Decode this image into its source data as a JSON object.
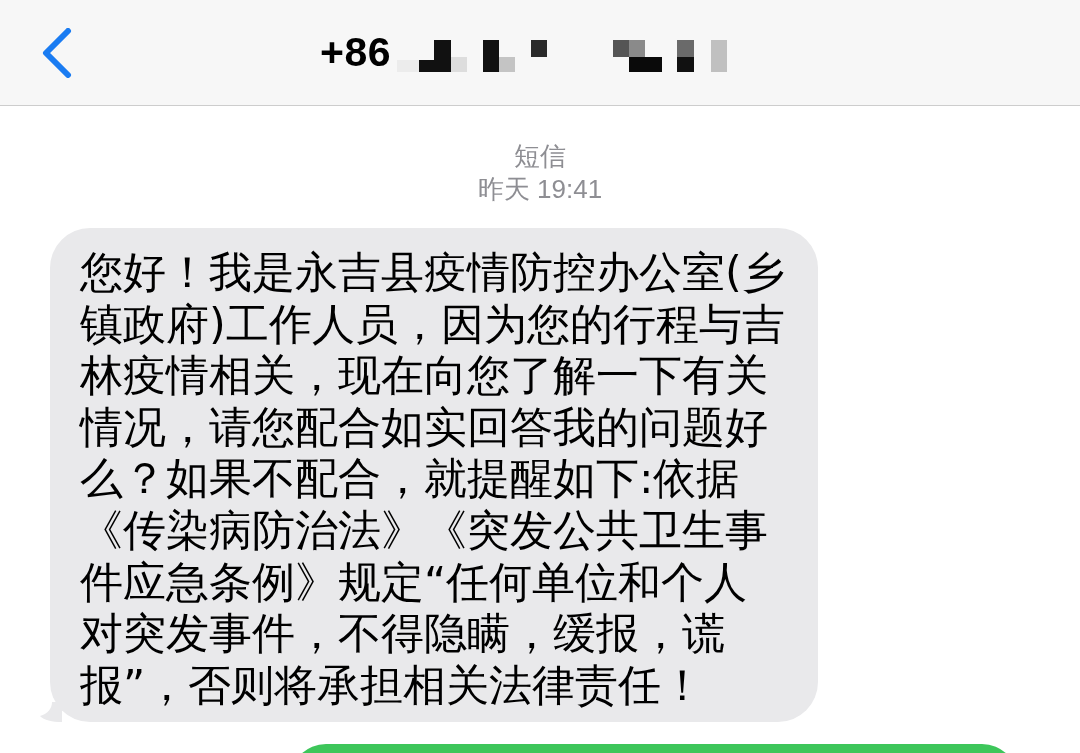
{
  "header": {
    "title": "+86",
    "redacted": true
  },
  "conversation": {
    "service": "短信",
    "timestamp": "昨天 19:41"
  },
  "messages": [
    {
      "kind": "incoming",
      "text": "您好！我是永吉县疫情防控办公室(乡镇政府)工作人员，因为您的行程与吉林疫情相关，现在向您了解一下有关情况，请您配合如实回答我的问题好么？如果不配合，就提醒如下:依据《传染病防治法》《突发公共卫生事件应急条例》规定“任何单位和个人对突发事件，不得隐瞒，缓报，谎报”，否则将承担相关法律责任！"
    },
    {
      "kind": "outgoing"
    }
  ]
}
